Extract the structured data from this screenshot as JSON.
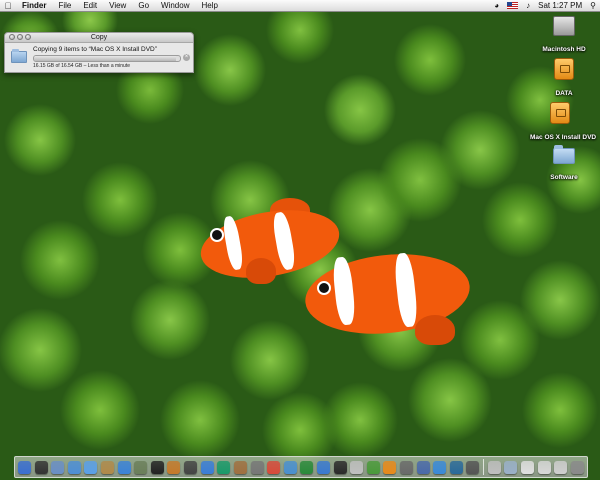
{
  "menubar": {
    "app_name": "Finder",
    "menus": [
      "File",
      "Edit",
      "View",
      "Go",
      "Window",
      "Help"
    ],
    "clock": "Sat 1:27 PM"
  },
  "copy_window": {
    "title": "Copy",
    "copy_title": "Copying 9 items to “Mac OS X Install DVD”",
    "status": "16.15 GB of 16.54 GB – Less than a minute",
    "progress_fraction": 0.976
  },
  "desktop_icons": [
    {
      "label": "Macintosh HD",
      "icon": "hard-drive-icon"
    },
    {
      "label": "DATA",
      "icon": "external-drive-icon"
    },
    {
      "label": "Mac OS X Install DVD",
      "icon": "external-drive-icon"
    },
    {
      "label": "Software",
      "icon": "folder-icon"
    }
  ],
  "dock": {
    "items": [
      {
        "name": "finder",
        "color": "#3b6fd0"
      },
      {
        "name": "dashboard",
        "color": "#333333"
      },
      {
        "name": "mail",
        "color": "#6a8fc5"
      },
      {
        "name": "safari",
        "color": "#4e8fd6"
      },
      {
        "name": "ichat",
        "color": "#5aa0e8"
      },
      {
        "name": "address-book",
        "color": "#b08a4a"
      },
      {
        "name": "itunes",
        "color": "#3b83d8"
      },
      {
        "name": "iphoto",
        "color": "#6b7f5a"
      },
      {
        "name": "imovie",
        "color": "#222222"
      },
      {
        "name": "garageband",
        "color": "#c57a2a"
      },
      {
        "name": "app-1",
        "color": "#444444"
      },
      {
        "name": "app-2",
        "color": "#3a7ed8"
      },
      {
        "name": "app-3",
        "color": "#1a9a6a"
      },
      {
        "name": "preview",
        "color": "#a07040"
      },
      {
        "name": "app-4",
        "color": "#777777"
      },
      {
        "name": "ical",
        "color": "#d84a3a"
      },
      {
        "name": "app-5",
        "color": "#4a90d0"
      },
      {
        "name": "app-6",
        "color": "#2a8a3a"
      },
      {
        "name": "app-7",
        "color": "#3a7ad0"
      },
      {
        "name": "app-8",
        "color": "#2a2a2a"
      },
      {
        "name": "app-9",
        "color": "#c0c0c0"
      },
      {
        "name": "app-10",
        "color": "#4a9a3a"
      },
      {
        "name": "vlc",
        "color": "#e88a1a"
      },
      {
        "name": "app-11",
        "color": "#6a6a6a"
      },
      {
        "name": "app-12",
        "color": "#4a6aaa"
      },
      {
        "name": "app-13",
        "color": "#3a8ad8"
      },
      {
        "name": "app-14",
        "color": "#2a6a9a"
      },
      {
        "name": "app-15",
        "color": "#555555"
      },
      {
        "name": "stack-1",
        "color": "#bfbfbf"
      },
      {
        "name": "stack-2",
        "color": "#9ab0c8"
      },
      {
        "name": "stack-3",
        "color": "#e0e0e0"
      },
      {
        "name": "stack-4",
        "color": "#d8d8d8"
      },
      {
        "name": "stack-5",
        "color": "#cfcfcf"
      },
      {
        "name": "trash",
        "color": "#8a8a8a"
      }
    ]
  }
}
